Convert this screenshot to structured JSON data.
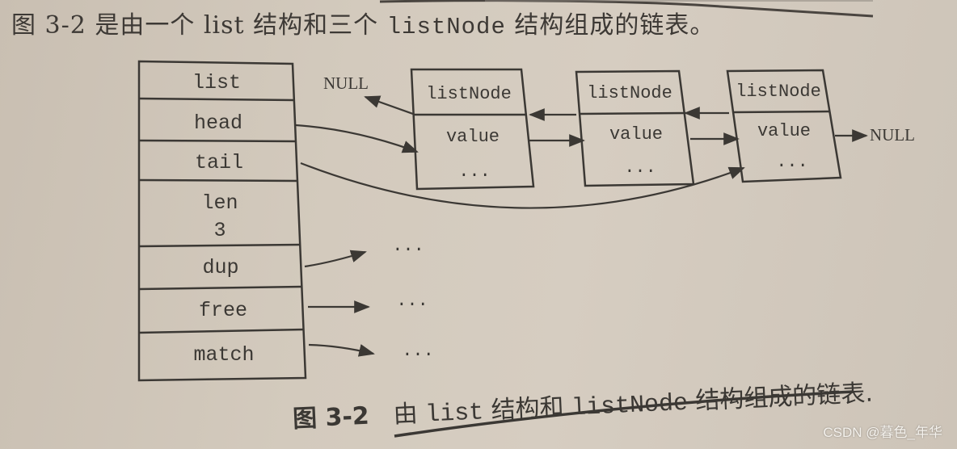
{
  "intro": {
    "prefix": "图 3-2 是由一个 list 结构和三个 ",
    "code": "listNode",
    "suffix": " 结构组成的链表。"
  },
  "list_struct": {
    "fields": [
      {
        "label": "list"
      },
      {
        "label": "head"
      },
      {
        "label": "tail"
      },
      {
        "label": "len",
        "value": "3"
      },
      {
        "label": "dup"
      },
      {
        "label": "free"
      },
      {
        "label": "match"
      }
    ]
  },
  "list_nodes": [
    {
      "title": "listNode",
      "value": "value",
      "more": "..."
    },
    {
      "title": "listNode",
      "value": "value",
      "more": "..."
    },
    {
      "title": "listNode",
      "value": "value",
      "more": "..."
    }
  ],
  "null_labels": {
    "prev_of_first": "NULL",
    "next_of_last": "NULL"
  },
  "function_targets": [
    "...",
    "...",
    "..."
  ],
  "caption": {
    "number": "图 3-2",
    "text_1": "由 ",
    "code_1": "list",
    "text_2": " 结构和 ",
    "code_2": "listNode",
    "text_3": " 结构组成的链表",
    "period": "."
  },
  "watermark": "CSDN @暮色_年华"
}
